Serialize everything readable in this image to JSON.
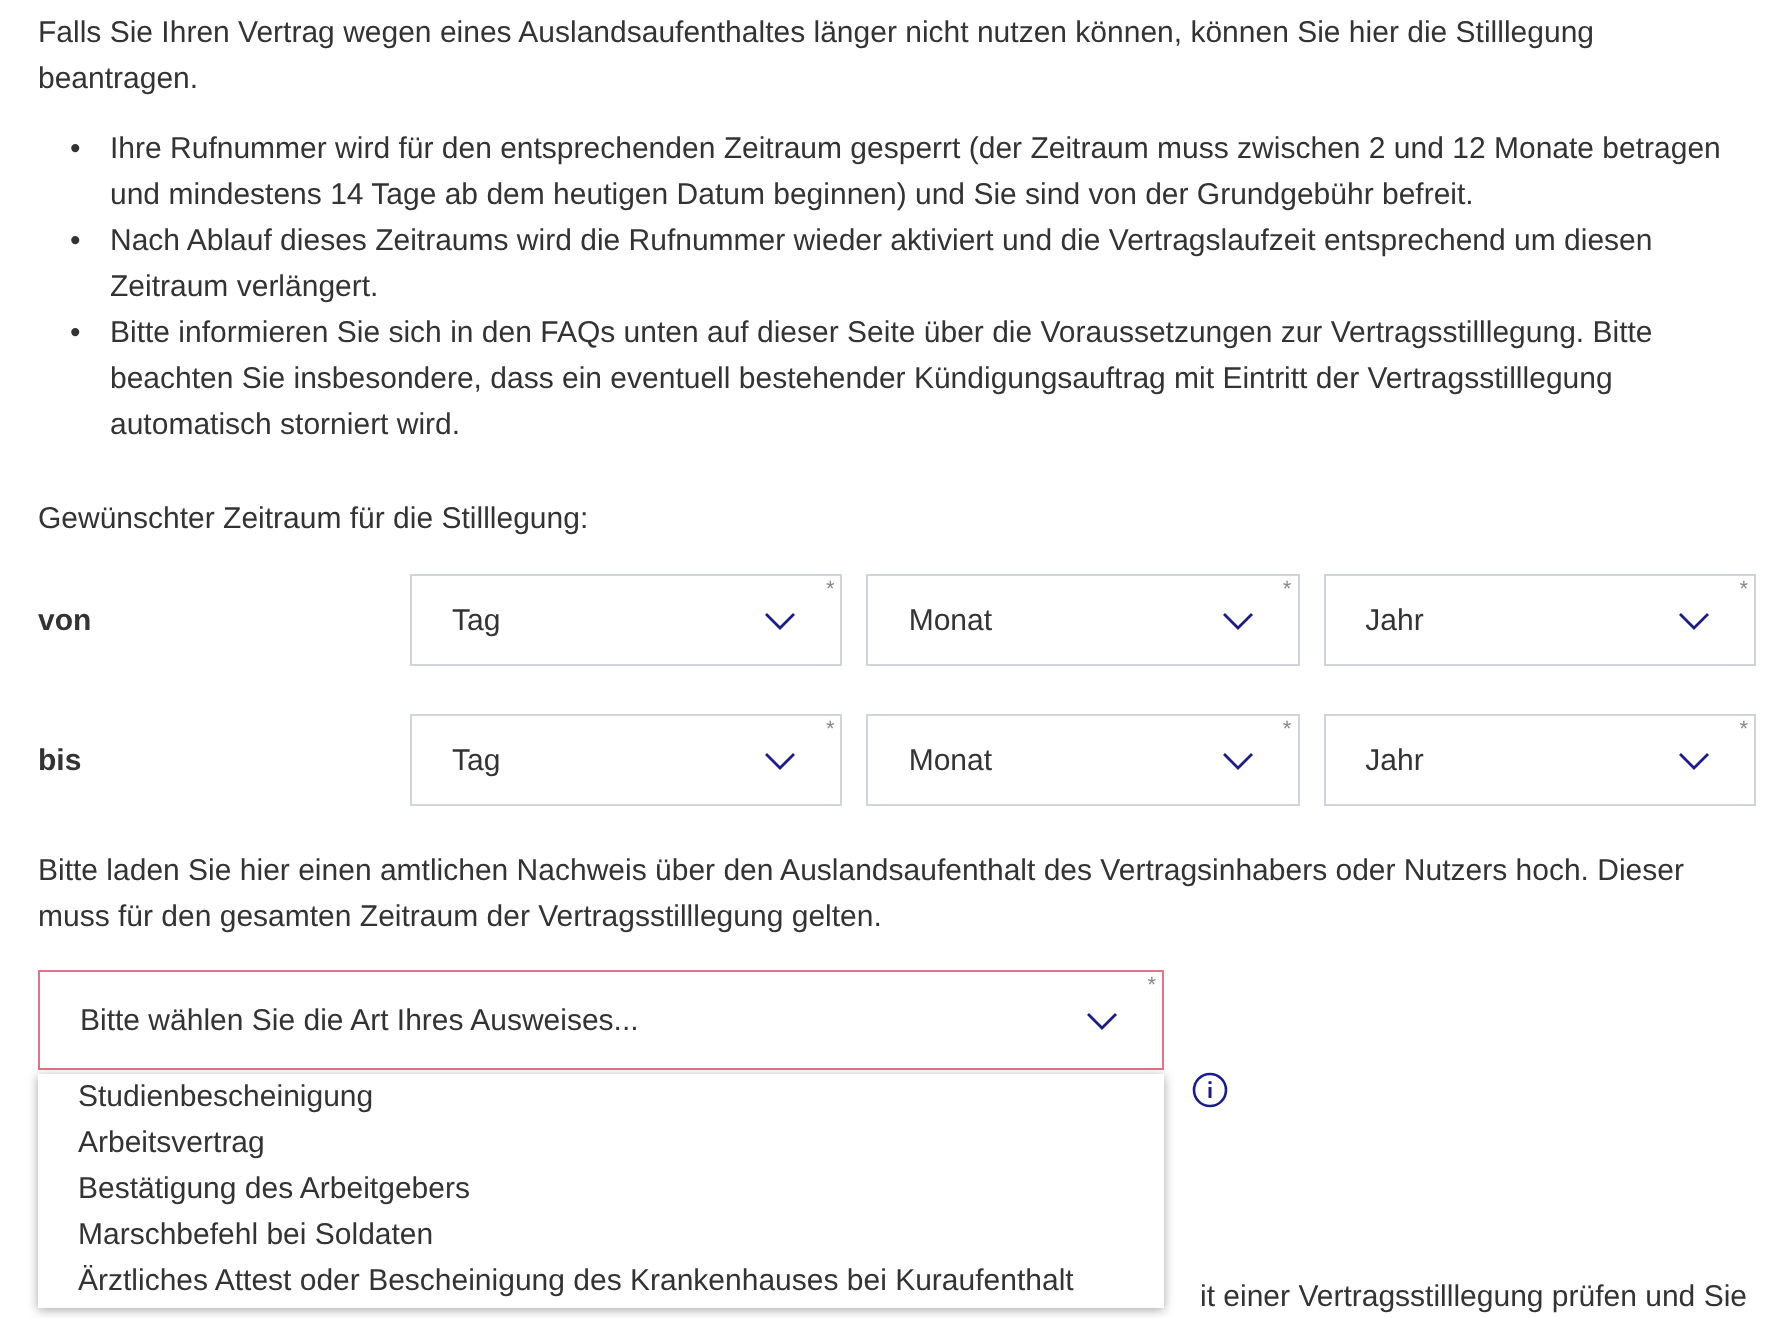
{
  "intro": "Falls Sie Ihren Vertrag wegen eines Auslandsaufenthaltes länger nicht nutzen können, können Sie hier die Stilllegung beantragen.",
  "bullets": [
    {
      "marker": "•",
      "text": "Ihre Rufnummer wird für den entsprechenden Zeitraum gesperrt (der Zeitraum muss zwischen 2 und 12 Monate betragen und mindestens 14 Tage ab dem heutigen Datum beginnen) und Sie sind von der Grundgebühr befreit."
    },
    {
      "marker": "•",
      "text": "Nach Ablauf dieses Zeitraums wird die Rufnummer wieder aktiviert und die Vertragslaufzeit entsprechend um diesen Zeitraum verlängert."
    },
    {
      "marker": "•",
      "text": "Bitte informieren Sie sich in den FAQs unten auf dieser Seite über die Voraussetzungen zur Vertragsstilllegung. Bitte beachten Sie insbesondere, dass ein eventuell bestehender Kündigungsauftrag mit Eintritt der Vertragsstilllegung automatisch storniert wird."
    }
  ],
  "period_label": "Gewünschter Zeitraum für die Stilllegung:",
  "date_rows": [
    {
      "label": "von",
      "selects": [
        {
          "placeholder": "Tag",
          "mark": "*"
        },
        {
          "placeholder": "Monat",
          "mark": "*"
        },
        {
          "placeholder": "Jahr",
          "mark": "*"
        }
      ]
    },
    {
      "label": "bis",
      "selects": [
        {
          "placeholder": "Tag",
          "mark": "*"
        },
        {
          "placeholder": "Monat",
          "mark": "*"
        },
        {
          "placeholder": "Jahr",
          "mark": "*"
        }
      ]
    }
  ],
  "upload_text": "Bitte laden Sie hier einen amtlichen Nachweis über den Auslandsaufenthalt des Vertragsinhabers oder Nutzers hoch. Dieser muss für den gesamten Zeitraum der Vertragsstilllegung gelten.",
  "id_select": {
    "placeholder": "Bitte wählen Sie die Art Ihres Ausweises...",
    "mark": "*",
    "invalid": true,
    "expanded": true,
    "options": [
      {
        "label": "Studienbescheinigung",
        "selected": false
      },
      {
        "label": "Arbeitsvertrag",
        "selected": false
      },
      {
        "label": "Bestätigung des Arbeitgebers",
        "selected": false
      },
      {
        "label": "Marschbefehl bei Soldaten",
        "selected": false
      },
      {
        "label": "Ärztliches Attest oder Bescheinigung des Krankenhauses bei Kuraufenthalt",
        "selected": false
      }
    ]
  },
  "footer_fragment": "it einer Vertragsstilllegung prüfen und Sie"
}
